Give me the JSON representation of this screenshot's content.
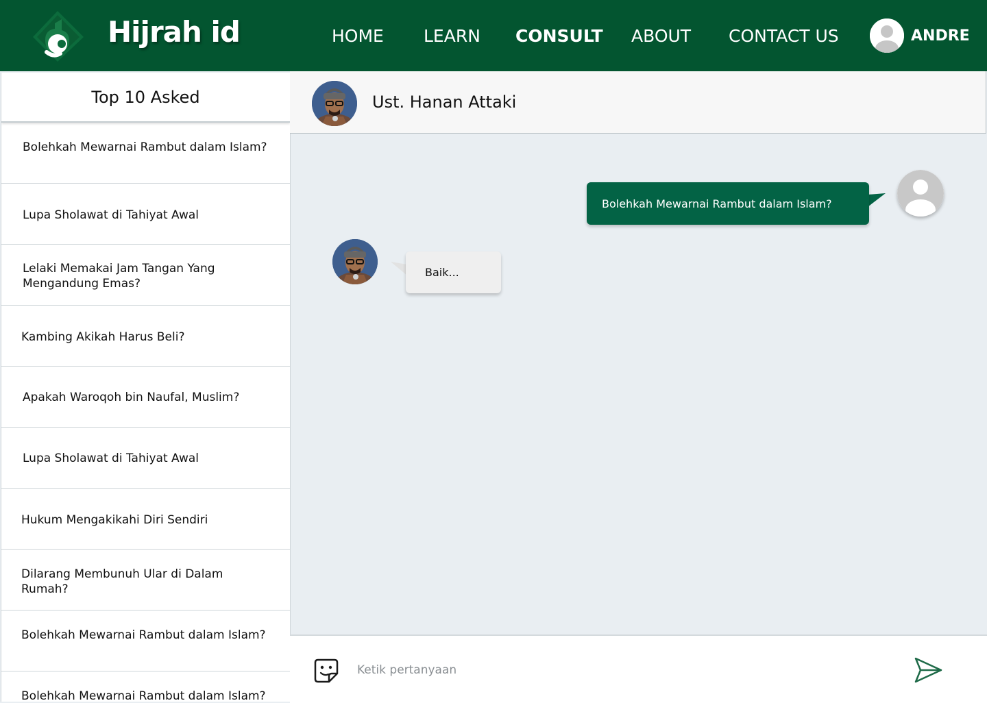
{
  "header": {
    "brand": "Hijrah id",
    "nav": {
      "home": "HOME",
      "learn": "LEARN",
      "consult": "CONSULT",
      "about": "ABOUT",
      "contact": "CONTACT US"
    },
    "active_nav": "CONSULT",
    "user_name": "ANDRE"
  },
  "sidebar": {
    "title": "Top 10 Asked",
    "questions": [
      "Bolehkah Mewarnai Rambut dalam Islam?",
      "Lupa Sholawat di Tahiyat Awal",
      "Lelaki Memakai Jam Tangan Yang Mengandung Emas?",
      "Kambing Akikah Harus Beli?",
      "Apakah Waroqoh bin Naufal, Muslim?",
      "Lupa Sholawat di Tahiyat Awal",
      "Hukum Mengakikahi Diri Sendiri",
      "Dilarang Membunuh Ular di Dalam Rumah?",
      "Bolehkah Mewarnai Rambut dalam Islam?",
      "Bolehkah Mewarnai Rambut dalam Islam?"
    ]
  },
  "chat": {
    "contact_name": "Ust. Hanan Attaki",
    "messages": {
      "outgoing": "Bolehkah Mewarnai Rambut dalam Islam?",
      "incoming": "Baik..."
    },
    "input_placeholder": "Ketik pertanyaan"
  },
  "colors": {
    "primary": "#035530",
    "bubble_outgoing": "#036345",
    "bubble_incoming": "#efefef",
    "chat_background": "#e9eef2"
  },
  "icons": {
    "logo": "hijrah-logo-icon",
    "user": "user-avatar-icon",
    "sticker": "sticker-smiley-icon",
    "send": "send-paper-plane-icon"
  }
}
